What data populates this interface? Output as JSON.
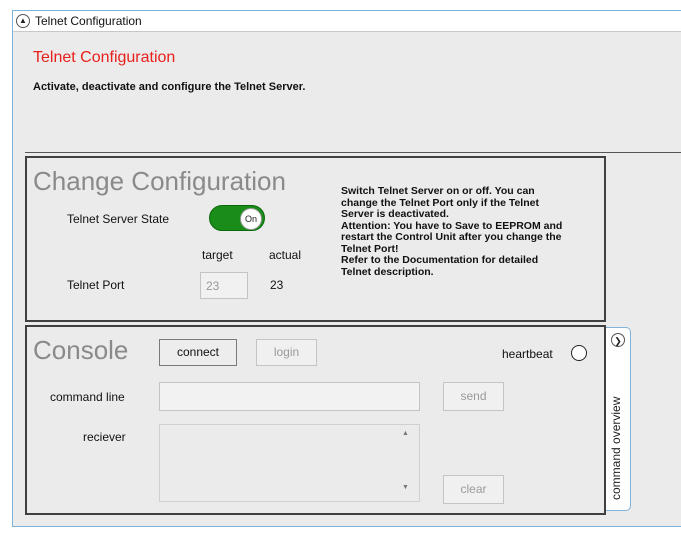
{
  "window": {
    "title": "Telnet Configuration",
    "collapse_icon": "chevron-up-icon"
  },
  "header": {
    "title": "Telnet Configuration",
    "description": "Activate, deactivate and configure the Telnet Server.",
    "title_color": "#e8201c"
  },
  "change_config": {
    "title": "Change Configuration",
    "server_state_label": "Telnet Server State",
    "toggle_label": "On",
    "toggle_state": "on",
    "toggle_color": "#1a8c1a",
    "target_label": "target",
    "actual_label": "actual",
    "port_label": "Telnet Port",
    "port_target": "23",
    "port_actual": "23",
    "hint_lines": [
      "Switch Telnet Server on or off. You can",
      "change the Telnet Port only if the Telnet",
      "Server is deactivated.",
      "Attention: You have to Save to EEPROM and",
      "restart the Control Unit after you change the",
      "Telnet Port!",
      "Refer to the Documentation for detailed",
      "Telnet description."
    ]
  },
  "console": {
    "title": "Console",
    "connect_label": "connect",
    "login_label": "login",
    "heartbeat_label": "heartbeat",
    "command_line_label": "command line",
    "command_line_value": "",
    "send_label": "send",
    "receiver_label": "reciever",
    "receiver_value": "",
    "clear_label": "clear"
  },
  "side_tab": {
    "label": "command overview",
    "icon": "chevron-right-icon"
  }
}
